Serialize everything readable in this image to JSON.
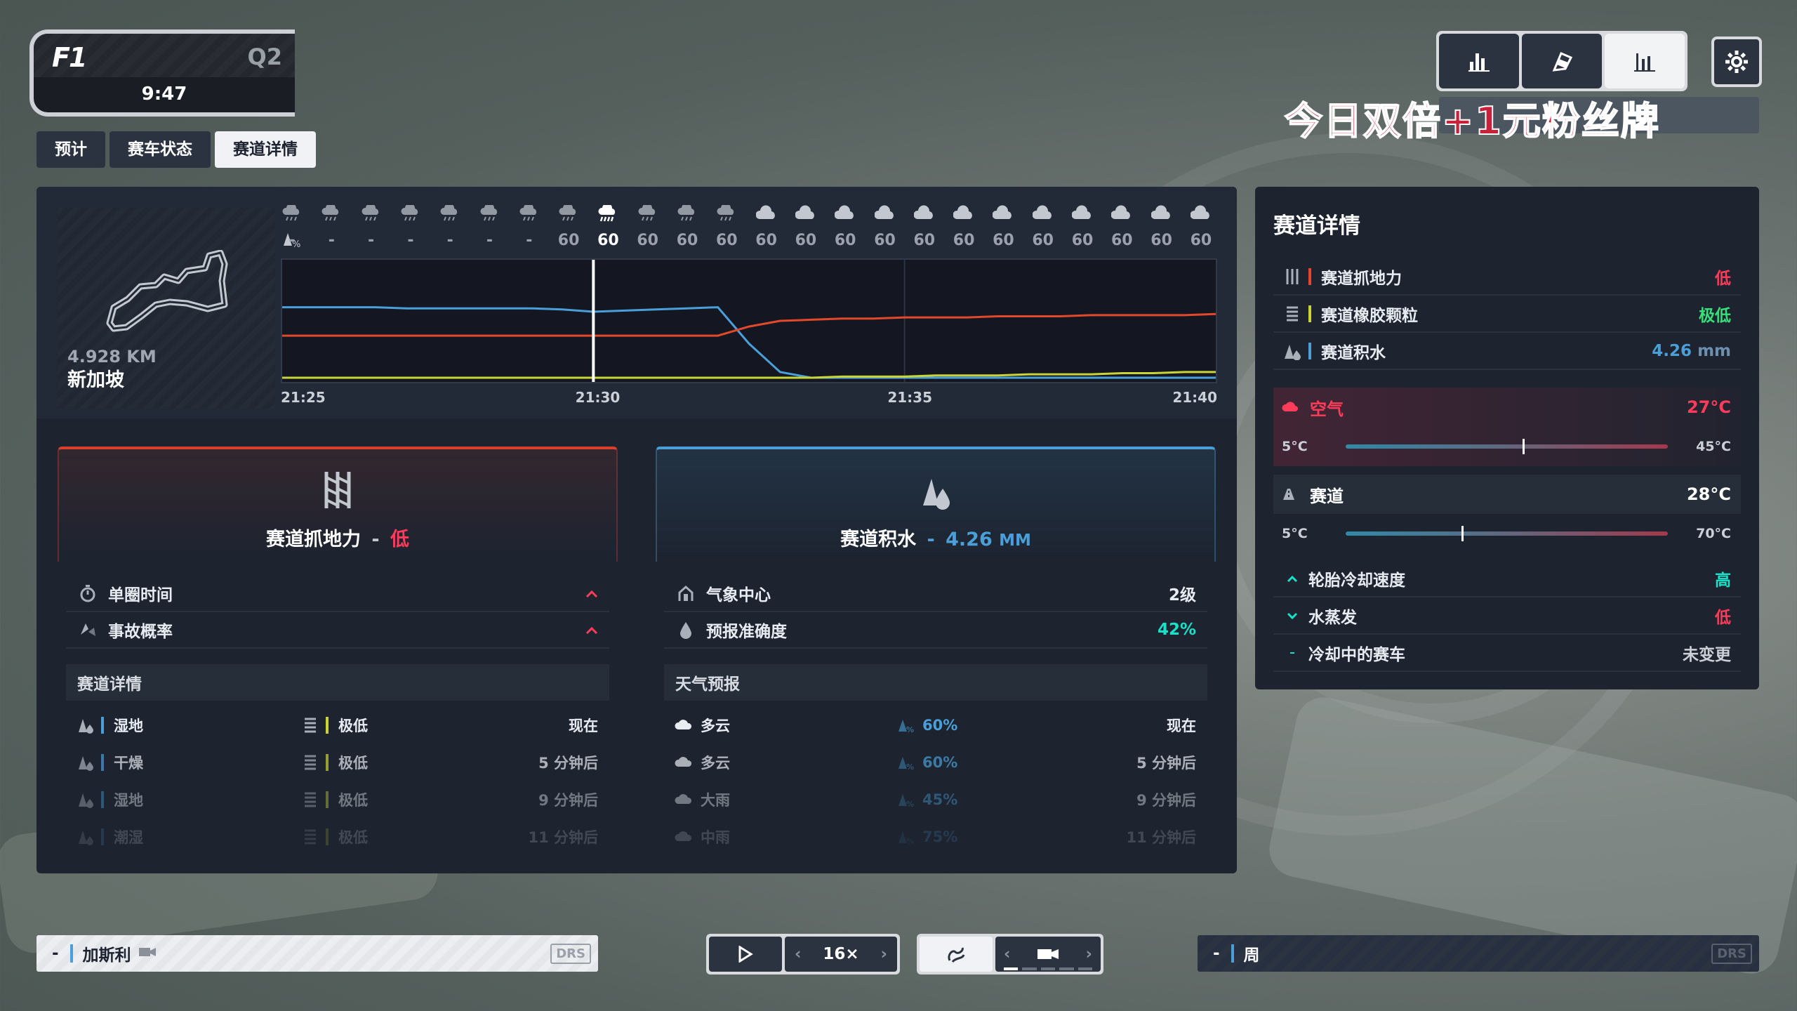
{
  "header": {
    "logo": "F1",
    "session": "Q2",
    "clock": "9:47"
  },
  "tabs": [
    {
      "label": "预计"
    },
    {
      "label": "赛车状态"
    },
    {
      "label": "赛道详情"
    }
  ],
  "watermark": "今日双倍+1元粉丝牌",
  "track": {
    "length": "4.928 KM",
    "name": "新加坡"
  },
  "forecast_strip": {
    "probabilities": [
      "-",
      "-",
      "-",
      "-",
      "-",
      "-",
      "-",
      "60",
      "60",
      "60",
      "60",
      "60",
      "60",
      "60",
      "60",
      "60",
      "60",
      "60",
      "60",
      "60",
      "60",
      "60",
      "60",
      "60"
    ],
    "icons": [
      "cloud-light-rain",
      "cloud-light-rain",
      "cloud-light-rain",
      "cloud-light-rain",
      "cloud-light-rain",
      "cloud-light-rain",
      "cloud-light-rain",
      "cloud-light-rain",
      "cloud-heavy-rain",
      "cloud-light-rain",
      "cloud-light-rain",
      "cloud-light-rain",
      "cloud",
      "cloud",
      "cloud",
      "cloud",
      "cloud",
      "cloud",
      "cloud",
      "cloud",
      "cloud",
      "cloud",
      "cloud",
      "cloud"
    ]
  },
  "chart_data": {
    "type": "line",
    "x_labels": [
      "21:25",
      "21:30",
      "21:35",
      "21:40"
    ],
    "series": [
      {
        "color": "#4a9fd8",
        "values": [
          0.62,
          0.62,
          0.62,
          0.62,
          0.61,
          0.61,
          0.61,
          0.61,
          0.61,
          0.6,
          0.58,
          0.59,
          0.6,
          0.61,
          0.62,
          0.3,
          0.05,
          0.0,
          0.0,
          0.0,
          0.0,
          0.0,
          0.0,
          0.0,
          0.0,
          0.0,
          0.0,
          0.0,
          0.0,
          0.0,
          0.0
        ]
      },
      {
        "color": "#e2492a",
        "values": [
          0.37,
          0.37,
          0.37,
          0.37,
          0.37,
          0.37,
          0.37,
          0.37,
          0.37,
          0.37,
          0.37,
          0.37,
          0.37,
          0.37,
          0.37,
          0.45,
          0.5,
          0.51,
          0.52,
          0.52,
          0.53,
          0.53,
          0.53,
          0.54,
          0.54,
          0.54,
          0.55,
          0.55,
          0.55,
          0.55,
          0.56
        ]
      },
      {
        "color": "#c9d436",
        "values": [
          0.0,
          0.0,
          0.0,
          0.0,
          0.0,
          0.0,
          0.0,
          0.0,
          0.0,
          0.0,
          0.0,
          0.0,
          0.0,
          0.0,
          0.0,
          0.0,
          0.0,
          0.0,
          0.01,
          0.01,
          0.01,
          0.02,
          0.02,
          0.02,
          0.03,
          0.03,
          0.03,
          0.04,
          0.04,
          0.05,
          0.05
        ]
      }
    ],
    "current_time": "21:30"
  },
  "grip_card": {
    "title": "赛道抓地力",
    "dash": "-",
    "level": "低",
    "rows": [
      {
        "icon": "stopwatch-icon",
        "label": "单圈时间"
      },
      {
        "icon": "accident-icon",
        "label": "事故概率"
      }
    ],
    "section_title": "赛道详情",
    "table": [
      {
        "state": "湿地",
        "state_color": "#4a9fd8",
        "rubber": "极低",
        "rubber_color": "#c9d436",
        "time": "现在",
        "opacity": 1
      },
      {
        "state": "干燥",
        "state_color": "#4a9fd8",
        "rubber": "极低",
        "rubber_color": "#c9d436",
        "time": "5 分钟后",
        "opacity": 0.7
      },
      {
        "state": "湿地",
        "state_color": "#4a9fd8",
        "rubber": "极低",
        "rubber_color": "#c9d436",
        "time": "9 分钟后",
        "opacity": 0.42
      },
      {
        "state": "潮湿",
        "state_color": "#4a9fd8",
        "rubber": "极低",
        "rubber_color": "#c9d436",
        "time": "11 分钟后",
        "opacity": 0.18
      }
    ]
  },
  "water_card": {
    "title": "赛道积水",
    "dash": "-",
    "value": "4.26",
    "unit": "MM",
    "rows": [
      {
        "icon": "weather-station-icon",
        "label": "气象中心",
        "value": "2级",
        "color": "#ffffff"
      },
      {
        "icon": "drop-icon",
        "label": "预报准确度",
        "value": "42%",
        "color": "#19e0c9"
      }
    ],
    "section_title": "天气预报",
    "table": [
      {
        "weather": "多云",
        "icon": "cloud-icon",
        "prob": "60%",
        "time": "现在",
        "opacity": 1
      },
      {
        "weather": "多云",
        "icon": "cloud-icon",
        "prob": "60%",
        "time": "5 分钟后",
        "opacity": 0.7
      },
      {
        "weather": "大雨",
        "icon": "heavy-rain-icon",
        "prob": "45%",
        "time": "9 分钟后",
        "opacity": 0.42
      },
      {
        "weather": "中雨",
        "icon": "rain-icon",
        "prob": "75%",
        "time": "11 分钟后",
        "opacity": 0.18
      }
    ]
  },
  "right_panel": {
    "title": "赛道详情",
    "rows": [
      {
        "label": "赛道抓地力",
        "bar_color": "#e2492a",
        "value": "低",
        "value_color": "#ff3d5a"
      },
      {
        "label": "赛道橡胶颗粒",
        "bar_color": "#c9d436",
        "value": "极低",
        "value_color": "#38e07a"
      },
      {
        "label": "赛道积水",
        "bar_color": "#4a9fd8",
        "value": "4.26",
        "unit": "mm",
        "value_color": "#4a9fd8"
      }
    ],
    "air": {
      "label": "空气",
      "value": "27°C",
      "min": "5°C",
      "max": "45°C",
      "level": 0.55
    },
    "track_temp": {
      "label": "赛道",
      "value": "28°C",
      "min": "5°C",
      "max": "70°C",
      "level": 0.36
    },
    "effects": [
      {
        "icon": "chevron-up-icon",
        "label": "轮胎冷却速度",
        "value": "高",
        "value_color": "#19e0c9"
      },
      {
        "icon": "chevron-down-icon",
        "label": "水蒸发",
        "value": "低",
        "value_color": "#ff3d5a"
      },
      {
        "icon": "dash-icon",
        "label": "冷却中的赛车",
        "value": "未变更",
        "value_color": "#cbd0d7"
      }
    ]
  },
  "bottom": {
    "left_pos": "-",
    "left_driver": "加斯利",
    "left_drs": "DRS",
    "speed": "16×",
    "right_pos": "-",
    "right_driver": "周",
    "right_drs": "DRS"
  }
}
